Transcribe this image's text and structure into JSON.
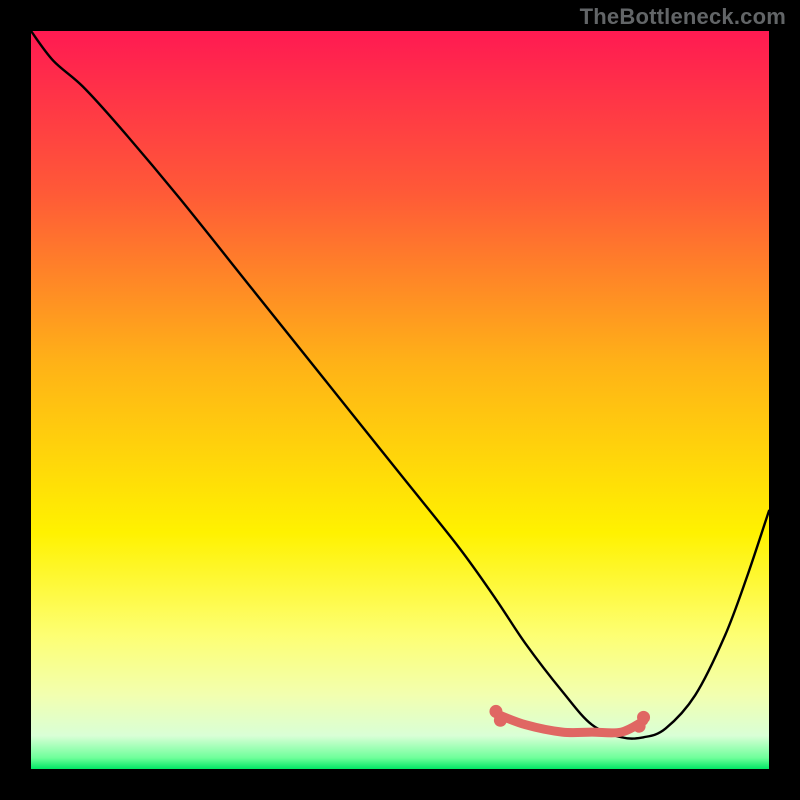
{
  "watermark": "TheBottleneck.com",
  "chart_data": {
    "type": "line",
    "title": "",
    "xlabel": "",
    "ylabel": "",
    "xlim": [
      0,
      100
    ],
    "ylim": [
      0,
      100
    ],
    "grid": false,
    "legend": false,
    "gradient_stops": [
      {
        "offset": 0.0,
        "color": "#ff1a52"
      },
      {
        "offset": 0.22,
        "color": "#ff5a37"
      },
      {
        "offset": 0.45,
        "color": "#ffb217"
      },
      {
        "offset": 0.68,
        "color": "#fff200"
      },
      {
        "offset": 0.82,
        "color": "#fdff74"
      },
      {
        "offset": 0.9,
        "color": "#f2ffb0"
      },
      {
        "offset": 0.955,
        "color": "#d9ffd6"
      },
      {
        "offset": 0.985,
        "color": "#6eff9a"
      },
      {
        "offset": 1.0,
        "color": "#00e765"
      }
    ],
    "series": [
      {
        "name": "bottleneck-curve",
        "color": "#000000",
        "stroke_width": 2.4,
        "x": [
          0.0,
          3.0,
          7.0,
          12.0,
          20.0,
          30.0,
          40.0,
          50.0,
          58.0,
          63.0,
          67.0,
          72.0,
          76.0,
          80.0,
          83.0,
          86.0,
          90.0,
          94.0,
          97.0,
          100.0
        ],
        "y": [
          100.0,
          96.0,
          92.5,
          87.0,
          77.5,
          65.0,
          52.5,
          40.0,
          30.0,
          23.0,
          17.0,
          10.5,
          6.0,
          4.3,
          4.3,
          5.5,
          10.0,
          18.0,
          26.0,
          35.0
        ]
      }
    ],
    "highlight": {
      "name": "flat-bottom-band",
      "color": "#e06763",
      "x": [
        63.0,
        67.0,
        72.0,
        76.0,
        80.0,
        83.0
      ],
      "y": [
        7.5,
        6.0,
        5.0,
        5.0,
        5.0,
        6.5
      ]
    },
    "highlight_dots": {
      "name": "flat-bottom-dots",
      "color": "#e06763",
      "points": [
        {
          "x": 63.0,
          "y": 7.8
        },
        {
          "x": 63.6,
          "y": 6.6
        },
        {
          "x": 82.4,
          "y": 5.8
        },
        {
          "x": 83.0,
          "y": 7.0
        }
      ]
    }
  }
}
